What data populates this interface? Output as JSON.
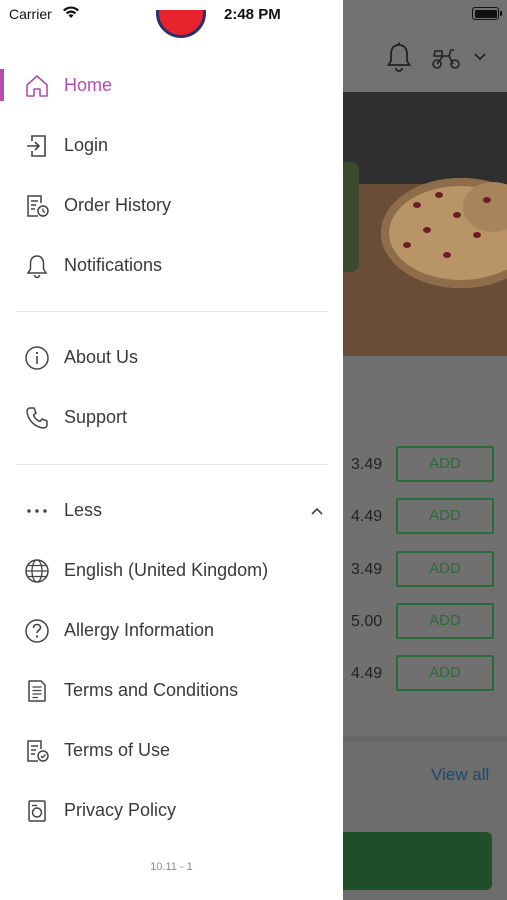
{
  "status_bar": {
    "carrier": "Carrier",
    "time": "2:48 PM"
  },
  "drawer": {
    "menu": [
      {
        "key": "home",
        "label": "Home",
        "icon": "home-icon",
        "active": true
      },
      {
        "key": "login",
        "label": "Login",
        "icon": "login-icon"
      },
      {
        "key": "order-history",
        "label": "Order History",
        "icon": "receipt-clock-icon"
      },
      {
        "key": "notifications",
        "label": "Notifications",
        "icon": "bell-icon"
      },
      {
        "key": "about-us",
        "label": "About Us",
        "icon": "info-icon"
      },
      {
        "key": "support",
        "label": "Support",
        "icon": "phone-icon"
      },
      {
        "key": "less",
        "label": "Less",
        "icon": "more-dots-icon"
      },
      {
        "key": "language",
        "label": "English (United Kingdom)",
        "icon": "globe-icon"
      },
      {
        "key": "allergy",
        "label": "Allergy Information",
        "icon": "question-icon"
      },
      {
        "key": "terms-conditions",
        "label": "Terms and Conditions",
        "icon": "document-icon"
      },
      {
        "key": "terms-of-use",
        "label": "Terms of Use",
        "icon": "document-check-icon"
      },
      {
        "key": "privacy",
        "label": "Privacy Policy",
        "icon": "shield-doc-icon"
      }
    ],
    "version": "10.11 - 1"
  },
  "background": {
    "prices": [
      "3.49",
      "4.49",
      "3.49",
      "5.00",
      "4.49"
    ],
    "add_label": "ADD",
    "view_all": "View all"
  },
  "colors": {
    "accent": "#b54db0",
    "add_green": "#2c6a39",
    "link_blue": "#174a73"
  }
}
